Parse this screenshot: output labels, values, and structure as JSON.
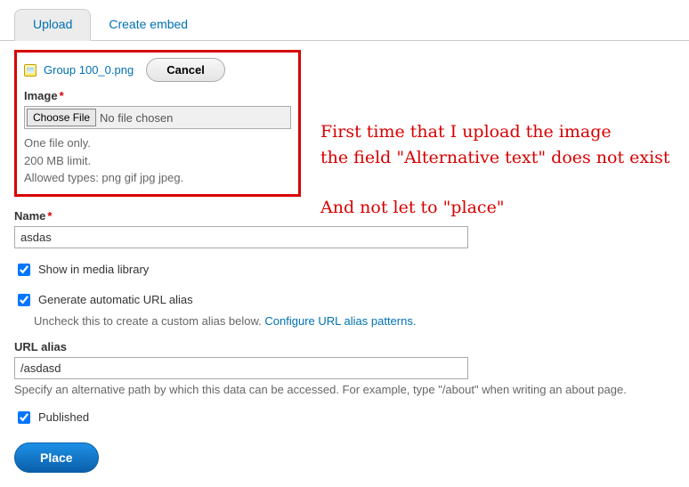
{
  "tabs": {
    "upload": "Upload",
    "create_embed": "Create embed"
  },
  "file": {
    "name": "Group 100_0.png",
    "cancel": "Cancel"
  },
  "image_field": {
    "label": "Image",
    "choose_file": "Choose File",
    "no_file": "No file chosen",
    "hint1": "One file only.",
    "hint2": "200 MB limit.",
    "hint3": "Allowed types: png gif jpg jpeg."
  },
  "name_field": {
    "label": "Name",
    "value": "asdas"
  },
  "show_in_library": "Show in media library",
  "auto_alias": {
    "label": "Generate automatic URL alias",
    "hint": "Uncheck this to create a custom alias below. ",
    "link": "Configure URL alias patterns."
  },
  "url_alias": {
    "label": "URL alias",
    "value": "/asdasd",
    "hint": "Specify an alternative path by which this data can be accessed. For example, type \"/about\" when writing an about page."
  },
  "published": "Published",
  "submit": "Place",
  "annotation": {
    "line1": "First time that I upload the image",
    "line2": "the field \"Alternative text\" does not exist",
    "line3": "And not let to \"place\""
  }
}
